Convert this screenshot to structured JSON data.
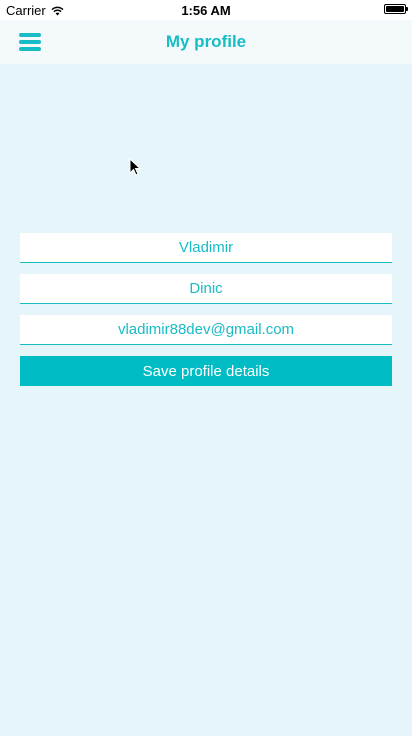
{
  "status_bar": {
    "carrier": "Carrier",
    "time": "1:56 AM",
    "wifi_icon": "wifi-icon",
    "battery_level": 1.0
  },
  "nav": {
    "title": "My profile",
    "menu_icon": "hamburger-menu-icon",
    "accent_color": "#18bcc5"
  },
  "form": {
    "first_name": "Vladimir",
    "last_name": "Dinic",
    "email": "vladimir88dev@gmail.com",
    "save_label": "Save profile details"
  }
}
